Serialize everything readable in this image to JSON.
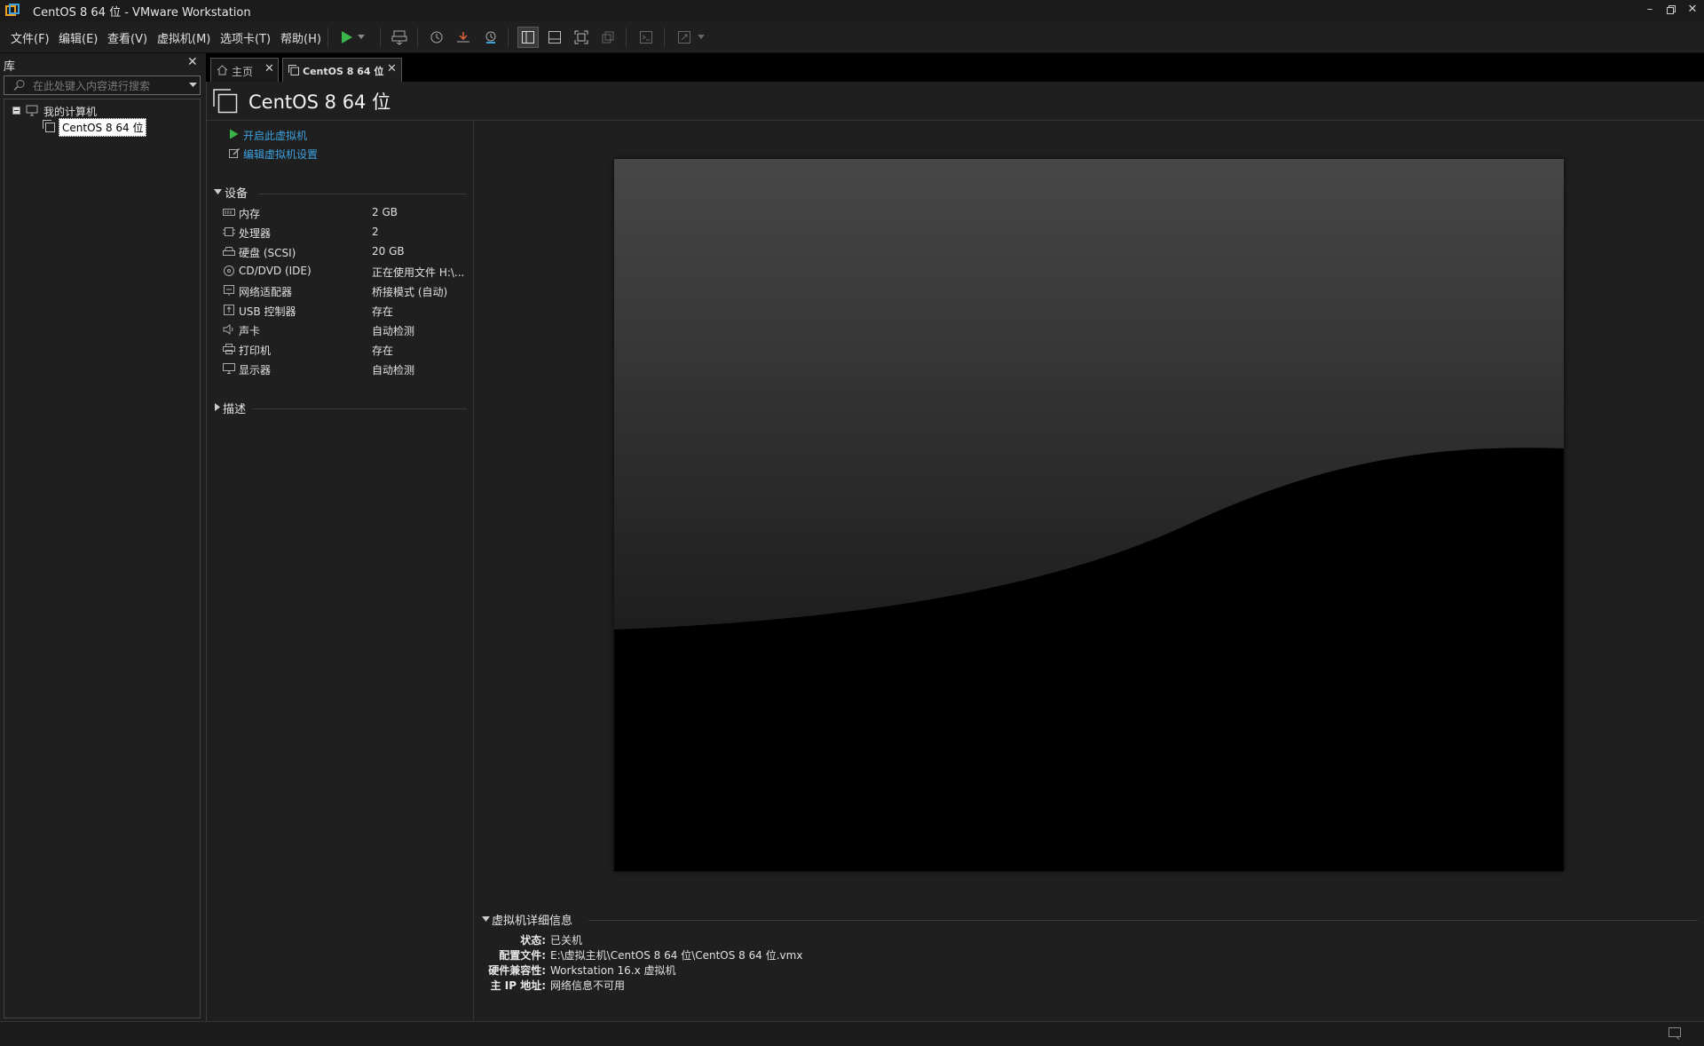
{
  "window": {
    "title": "CentOS 8 64 位 - VMware Workstation",
    "controls": [
      "minimize",
      "maximize",
      "close"
    ]
  },
  "menu": [
    "文件(F)",
    "编辑(E)",
    "查看(V)",
    "虚拟机(M)",
    "选项卡(T)",
    "帮助(H)"
  ],
  "toolbar": {
    "buttons": [
      "play-icon",
      "dropdown-icon",
      "send-keys-icon",
      "snapshot-icon",
      "revert-snapshot-icon",
      "snapshot-manager-icon",
      "library-view-icon",
      "thumbnail-view-icon",
      "fullscreen-icon",
      "unity-icon",
      "console-icon",
      "stretch-icon"
    ],
    "accent_color": "#39b54a"
  },
  "library": {
    "title": "库",
    "search_placeholder": "在此处键入内容进行搜索",
    "tree": {
      "root": "我的计算机",
      "vm": "CentOS 8 64 位"
    }
  },
  "tabs": [
    {
      "label": "主页",
      "active": false
    },
    {
      "label": "CentOS 8 64 位",
      "active": true
    }
  ],
  "vm": {
    "title": "CentOS 8 64 位",
    "actions": {
      "start": "开启此虚拟机",
      "edit": "编辑虚拟机设置"
    },
    "devices_header": "设备",
    "devices": [
      {
        "name": "内存",
        "value": "2 GB",
        "icon": "memory-icon"
      },
      {
        "name": "处理器",
        "value": "2",
        "icon": "cpu-icon"
      },
      {
        "name": "硬盘 (SCSI)",
        "value": "20 GB",
        "icon": "harddisk-icon"
      },
      {
        "name": "CD/DVD (IDE)",
        "value": "正在使用文件 H:\\...",
        "icon": "cdrom-icon"
      },
      {
        "name": "网络适配器",
        "value": "桥接模式 (自动)",
        "icon": "network-icon"
      },
      {
        "name": "USB 控制器",
        "value": "存在",
        "icon": "usb-icon"
      },
      {
        "name": "声卡",
        "value": "自动检测",
        "icon": "sound-icon"
      },
      {
        "name": "打印机",
        "value": "存在",
        "icon": "printer-icon"
      },
      {
        "name": "显示器",
        "value": "自动检测",
        "icon": "display-icon"
      }
    ],
    "description_header": "描述",
    "details_header": "虚拟机详细信息",
    "details": [
      {
        "label": "状态:",
        "value": "已关机"
      },
      {
        "label": "配置文件:",
        "value": "E:\\虚拟主机\\CentOS 8 64 位\\CentOS 8 64 位.vmx"
      },
      {
        "label": "硬件兼容性:",
        "value": "Workstation 16.x 虚拟机"
      },
      {
        "label": "主 IP 地址:",
        "value": "网络信息不可用"
      }
    ],
    "link_color": "#3ea1df"
  }
}
